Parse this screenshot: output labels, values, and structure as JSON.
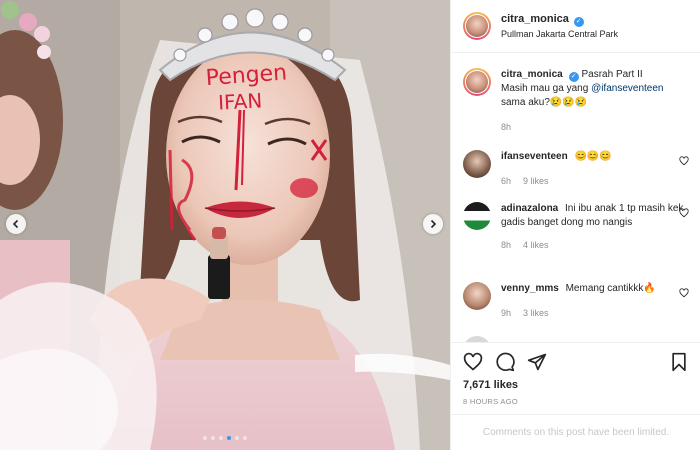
{
  "post": {
    "author": {
      "username": "citra_monica",
      "verified": true,
      "location": "Pullman Jakarta Central Park"
    },
    "caption": {
      "username": "citra_monica",
      "text_prefix": "Pasrah Part II",
      "line2_text": "Masih mau ga yang ",
      "mention": "@ifanseventeen",
      "line3_text": "sama aku?😢😢😢",
      "time": "8h"
    },
    "media": {
      "face_text_forehead_1": "Pengen",
      "face_text_forehead_2": "IFAN",
      "carousel_dots": 6,
      "active_dot": 3
    },
    "comments": [
      {
        "username": "ifanseventeen",
        "text": "😊😊😊",
        "time": "6h",
        "likes": "9 likes"
      },
      {
        "username": "adinazalona",
        "text": "Ini ibu anak 1 tp masih kek gadis banget dong mo nangis",
        "time": "8h",
        "likes": "4 likes"
      },
      {
        "username": "venny_mms",
        "text": "Memang cantikkk🔥",
        "time": "9h",
        "likes": "3 likes"
      }
    ],
    "likes": "7,671 likes",
    "timestamp": "8 HOURS AGO",
    "comments_limited": "Comments on this post have been limited."
  },
  "colors": {
    "accent": "#3897f0",
    "muted": "#8e8e8e",
    "lipstick": "#d4203a"
  },
  "icons": [
    "chevron-left-icon",
    "chevron-right-icon",
    "heart-icon",
    "comment-icon",
    "share-icon",
    "bookmark-icon",
    "verified-icon"
  ]
}
